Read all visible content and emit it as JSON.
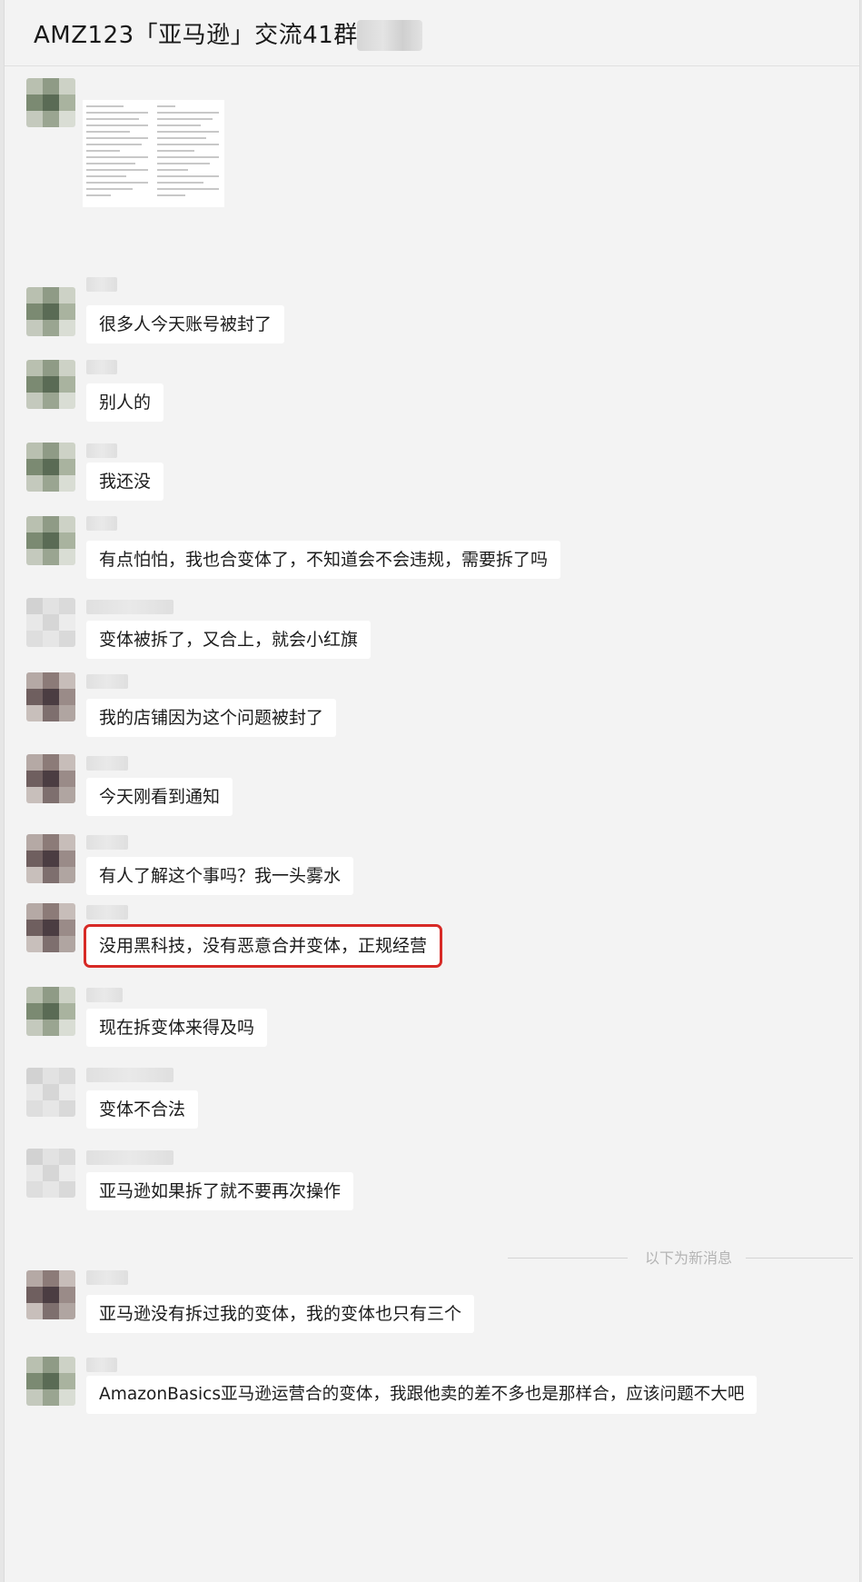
{
  "header": {
    "title": "AMZ123「亚马逊」交流41群"
  },
  "divider": {
    "new_messages": "以下为新消息"
  },
  "messages": [
    {
      "text": "很多人今天账号被封了"
    },
    {
      "text": "别人的"
    },
    {
      "text": "我还没"
    },
    {
      "text": "有点怕怕，我也合变体了，不知道会不会违规，需要拆了吗"
    },
    {
      "text": "变体被拆了，又合上，就会小红旗"
    },
    {
      "text": "我的店铺因为这个问题被封了"
    },
    {
      "text": "今天刚看到通知"
    },
    {
      "text": "有人了解这个事吗？我一头雾水"
    },
    {
      "text": "没用黑科技，没有恶意合并变体，正规经营",
      "highlighted": true,
      "highlight_color": "#d72a26"
    },
    {
      "text": "现在拆变体来得及吗"
    },
    {
      "text": "变体不合法"
    },
    {
      "text": "亚马逊如果拆了就不要再次操作"
    },
    {
      "text": "亚马逊没有拆过我的变体，我的变体也只有三个"
    },
    {
      "text": "AmazonBasics亚马逊运营合的变体，我跟他卖的差不多也是那样合，应该问题不大吧"
    }
  ],
  "icons": {
    "avatar": "blurred-avatar",
    "attachment": "document-image"
  }
}
